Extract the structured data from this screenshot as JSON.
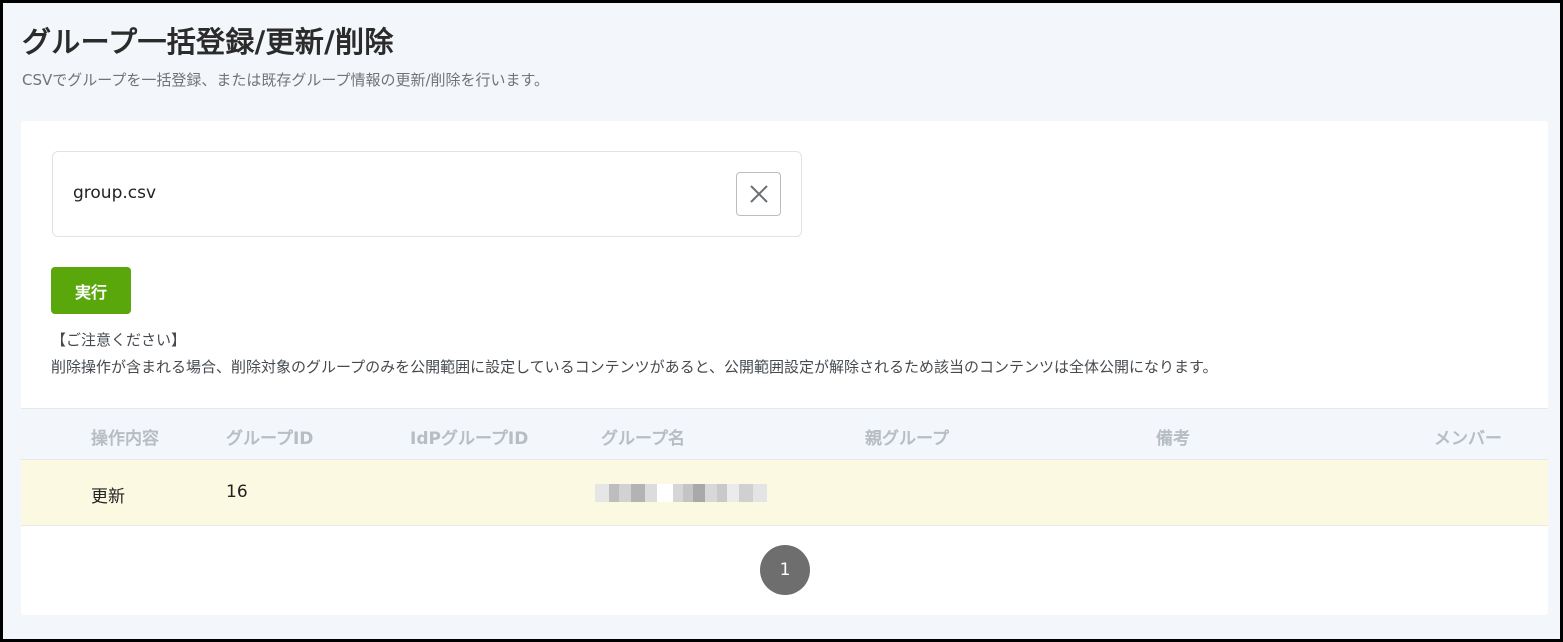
{
  "header": {
    "title": "グループ一括登録/更新/削除",
    "description": "CSVでグループを一括登録、または既存グループ情報の更新/削除を行います。"
  },
  "upload": {
    "file_name": "group.csv",
    "clear_icon": "close-icon"
  },
  "actions": {
    "run_label": "実行",
    "run_color": "#5aa70c"
  },
  "notice": {
    "title": "【ご注意ください】",
    "text": "削除操作が含まれる場合、削除対象のグループのみを公開範囲に設定しているコンテンツがあると、公開範囲設定が解除されるため該当のコンテンツは全体公開になります。"
  },
  "table": {
    "columns": [
      "操作内容",
      "グループID",
      "IdPグループID",
      "グループ名",
      "親グループ",
      "備考",
      "メンバー"
    ],
    "rows": [
      {
        "operation": "更新",
        "group_id": "16",
        "idp_group_id": "",
        "group_name": "",
        "parent_group": "",
        "note": "",
        "members": ""
      }
    ]
  },
  "pagination": {
    "current_page": "1"
  }
}
